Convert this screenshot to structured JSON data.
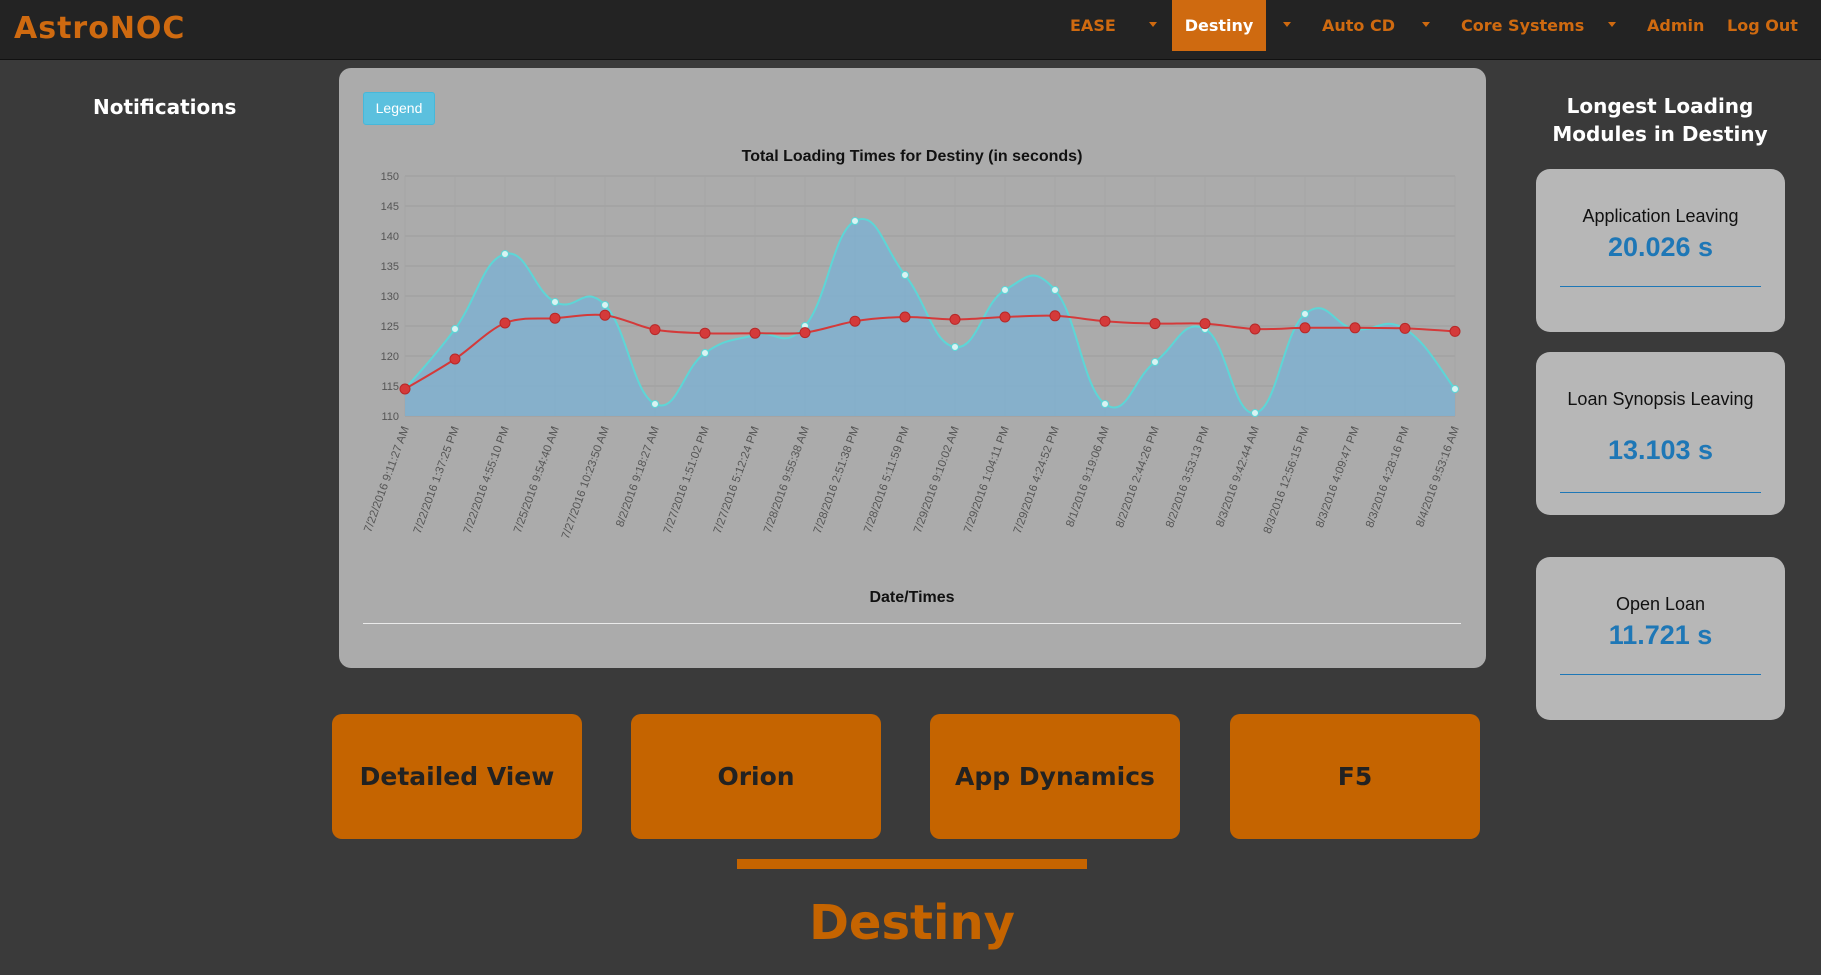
{
  "navbar": {
    "logo": "AstroNOC",
    "items": [
      {
        "label": "EASE",
        "has_dropdown": true
      },
      {
        "label": "Destiny",
        "has_dropdown": true,
        "active": true
      },
      {
        "label": "Auto CD",
        "has_dropdown": true
      },
      {
        "label": "Core Systems",
        "has_dropdown": true
      },
      {
        "label": "Admin"
      },
      {
        "label": "Log Out"
      }
    ]
  },
  "sidebar": {
    "title": "Notifications"
  },
  "chart_panel": {
    "legend_button": "Legend"
  },
  "chart_data": {
    "type": "line",
    "title": "Total Loading Times for Destiny (in seconds)",
    "xlabel": "Date/Times",
    "ylabel": "",
    "ylim": [
      110,
      150
    ],
    "yticks": [
      110,
      115,
      120,
      125,
      130,
      135,
      140,
      145,
      150
    ],
    "grid": true,
    "categories": [
      "7/22/2016 9:11:27 AM",
      "7/22/2016 1:37:25 PM",
      "7/22/2016 4:55:10 PM",
      "7/25/2016 9:54:40 AM",
      "7/27/2016 10:23:50 AM",
      "8/2/2016 9:18:27 AM",
      "7/27/2016 1:51:02 PM",
      "7/27/2016 5:12:24 PM",
      "7/28/2016 9:55:38 AM",
      "7/28/2016 2:51:38 PM",
      "7/28/2016 5:11:59 PM",
      "7/29/2016 9:10:02 AM",
      "7/29/2016 1:04:11 PM",
      "7/29/2016 4:24:52 PM",
      "8/1/2016 9:19:06 AM",
      "8/2/2016 2:44:26 PM",
      "8/2/2016 3:53:13 PM",
      "8/3/2016 9:42:44 AM",
      "8/3/2016 12:56:15 PM",
      "8/3/2016 4:09:47 PM",
      "8/3/2016 4:28:16 PM",
      "8/4/2016 9:53:16 AM"
    ],
    "series": [
      {
        "color": "#5dd6d6",
        "fill": "#7fb0d0",
        "values": [
          114.5,
          124.5,
          137,
          129,
          128.5,
          112,
          120.5,
          123.5,
          125,
          142.5,
          133.5,
          121.5,
          131,
          131,
          112,
          119,
          124.5,
          110.5,
          127,
          124.5,
          124.5,
          114.5
        ]
      },
      {
        "color": "#d43a3a",
        "values": [
          114.5,
          119.5,
          125.5,
          126.3,
          126.8,
          124.4,
          123.8,
          123.8,
          123.9,
          125.8,
          126.5,
          126.1,
          126.5,
          126.7,
          125.8,
          125.4,
          125.4,
          124.5,
          124.7,
          124.7,
          124.6,
          124.1
        ]
      }
    ]
  },
  "modules": {
    "title": "Longest Loading Modules in Destiny",
    "cards": [
      {
        "name": "Application Leaving",
        "value": "20.026 s"
      },
      {
        "name": "Loan Synopsis Leaving",
        "value": "13.103 s"
      },
      {
        "name": "Open Loan",
        "value": "11.721 s"
      }
    ]
  },
  "buttons": [
    {
      "label": "Detailed View"
    },
    {
      "label": "Orion"
    },
    {
      "label": "App Dynamics"
    },
    {
      "label": "F5"
    }
  ],
  "page_heading": "Destiny",
  "colors": {
    "accent": "#cf6a10",
    "button_bg": "#c56400",
    "value_blue": "#1e77b6",
    "legend_btn": "#5bc0de"
  }
}
